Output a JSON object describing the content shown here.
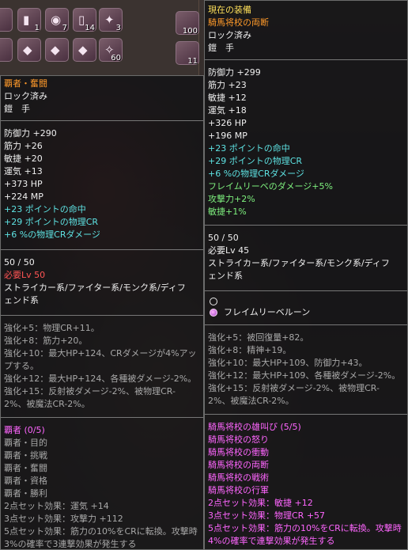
{
  "inventory": {
    "slots": [
      {
        "glyph": "▮",
        "count": "1"
      },
      {
        "glyph": "◉",
        "count": "7"
      },
      {
        "glyph": "▯",
        "count": "14"
      },
      {
        "glyph": "✦",
        "count": "3"
      },
      {
        "glyph": "◆",
        "count": ""
      },
      {
        "glyph": "◆",
        "count": ""
      },
      {
        "glyph": "◆",
        "count": ""
      },
      {
        "glyph": "✧",
        "count": "60"
      }
    ],
    "side_counts": [
      "100",
      "11"
    ]
  },
  "left_tooltip": {
    "name": "覇者・奮闘",
    "status": "ロック済み",
    "slot": "鎧　手",
    "stats": [
      "防御力 +290",
      "筋力 +26",
      "敏捷 +20",
      "運気 +13",
      "+373 HP",
      "+224 MP"
    ],
    "bonus": [
      "+23 ポイントの命中",
      "+29 ポイントの物理CR",
      "+6 %の物理CRダメージ"
    ],
    "durability": "50 / 50",
    "required_level": "必要Lv 50",
    "classes": "ストライカー系/ファイター系/モンク系/ディフェンド系",
    "enhance": [
      "強化+5：物理CR+11。",
      "強化+8：筋力+20。",
      "強化+10：最大HP+124、CRダメージが4%アップする。",
      "強化+12：最大HP+124、各種被ダメージ-2%。",
      "強化+15：反射被ダメージ-2%、被物理CR-2%、被魔法CR-2%。"
    ],
    "set_title": "覇者 (0/5)",
    "set_items": [
      "覇者・目的",
      "覇者・挑戦",
      "覇者・奮闘",
      "覇者・資格",
      "覇者・勝利"
    ],
    "set_effects": [
      "2点セット効果：運気 +14",
      "3点セット効果：攻撃力 +112",
      "5点セット効果：筋力の10%をCRに転換。攻撃時 3%の確率で3連撃効果が発生する"
    ]
  },
  "right_tooltip": {
    "header": "現在の装備",
    "name": "騎馬将校の両断",
    "status": "ロック済み",
    "slot": "鎧　手",
    "stats": [
      "防御力 +299",
      "筋力 +23",
      "敏捷 +12",
      "運気 +18",
      "+326 HP",
      "+196 MP"
    ],
    "bonus": [
      "+23 ポイントの命中",
      "+29 ポイントの物理CR",
      "+6 %の物理CRダメージ",
      "フレイムリーベのダメージ+5%",
      "攻撃力+2%",
      "敏捷+1%"
    ],
    "durability": "50 / 50",
    "required_level": "必要Lv 45",
    "classes": "ストライカー系/ファイター系/モンク系/ディフェンド系",
    "gems": [
      {
        "filled": false,
        "label": ""
      },
      {
        "filled": true,
        "label": "フレイムリーベルーン"
      }
    ],
    "enhance": [
      "強化+5：被回復量+82。",
      "強化+8：精神+19。",
      "強化+10：最大HP+109、防御力+43。",
      "強化+12：最大HP+109、各種被ダメージ-2%。",
      "強化+15：反射被ダメージ-2%、被物理CR-2%、被魔法CR-2%。"
    ],
    "set_title": "騎馬将校の雄叫び (5/5)",
    "set_items": [
      "騎馬将校の怒り",
      "騎馬将校の衝動",
      "騎馬将校の両断",
      "騎馬将校の戦術",
      "騎馬将校の行軍"
    ],
    "set_effects": [
      "2点セット効果：敏捷 +12",
      "3点セット効果：物理CR +57",
      "5点セット効果：筋力の10%をCRに転換。攻撃時 4%の確率で連撃効果が発生する"
    ]
  }
}
